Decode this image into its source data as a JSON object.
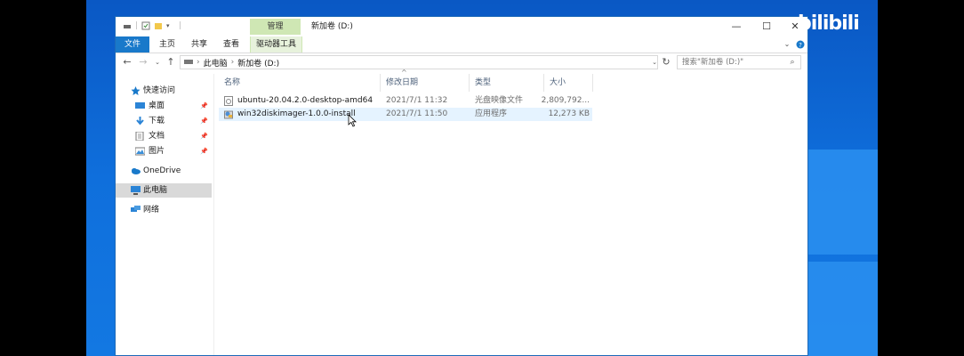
{
  "window": {
    "title": "新加卷 (D:)",
    "context_tab": "管理",
    "controls": {
      "minimize": "—",
      "maximize": "☐",
      "close": "✕"
    }
  },
  "ribbon": {
    "tabs": [
      {
        "label": "文件"
      },
      {
        "label": "主页"
      },
      {
        "label": "共享"
      },
      {
        "label": "查看"
      },
      {
        "label": "驱动器工具"
      }
    ]
  },
  "address": {
    "crumbs": [
      "此电脑",
      "新加卷 (D:)"
    ],
    "separator": "›",
    "search_placeholder": "搜索\"新加卷 (D:)\""
  },
  "nav": {
    "quick_access": "快速访问",
    "items": [
      {
        "label": "桌面"
      },
      {
        "label": "下载"
      },
      {
        "label": "文档"
      },
      {
        "label": "图片"
      }
    ],
    "onedrive": "OneDrive",
    "this_pc": "此电脑",
    "network": "网络"
  },
  "columns": {
    "name": "名称",
    "date": "修改日期",
    "type": "类型",
    "size": "大小"
  },
  "files": [
    {
      "name": "ubuntu-20.04.2.0-desktop-amd64",
      "date": "2021/7/1 11:32",
      "type": "光盘映像文件",
      "size": "2,809,792..."
    },
    {
      "name": "win32diskimager-1.0.0-install",
      "date": "2021/7/1 11:50",
      "type": "应用程序",
      "size": "12,273 KB"
    }
  ],
  "watermark": {
    "text": "bilibili"
  }
}
